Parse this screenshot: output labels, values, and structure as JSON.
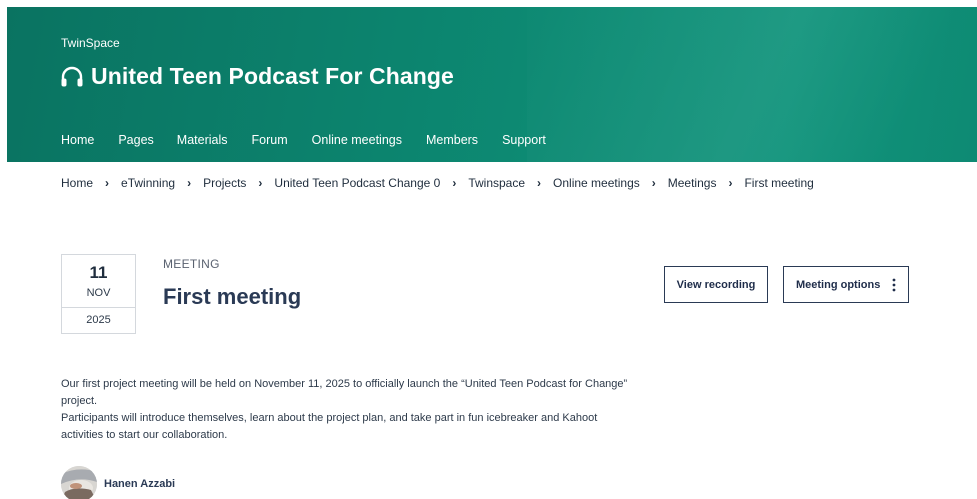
{
  "header": {
    "site_name": "TwinSpace",
    "project_title": "United Teen Podcast For Change",
    "title_icon": "headphones-icon",
    "nav": [
      {
        "label": "Home"
      },
      {
        "label": "Pages"
      },
      {
        "label": "Materials"
      },
      {
        "label": "Forum"
      },
      {
        "label": "Online meetings"
      },
      {
        "label": "Members"
      },
      {
        "label": "Support"
      }
    ],
    "colors": {
      "background": "#0d8a73",
      "text": "#ffffff"
    }
  },
  "breadcrumb": [
    {
      "label": "Home"
    },
    {
      "label": "eTwinning"
    },
    {
      "label": "Projects"
    },
    {
      "label": "United Teen Podcast Change 0"
    },
    {
      "label": "Twinspace"
    },
    {
      "label": "Online meetings"
    },
    {
      "label": "Meetings"
    },
    {
      "label": "First meeting"
    }
  ],
  "meeting": {
    "date": {
      "day": "11",
      "month": "NOV",
      "year": "2025"
    },
    "kind_label": "MEETING",
    "title": "First meeting",
    "actions": {
      "view_recording": "View recording",
      "meeting_options": "Meeting options",
      "options_icon": "kebab-menu-icon"
    },
    "description": [
      "Our first project meeting will be held on November 11, 2025 to officially launch the “United Teen Podcast for Change” project.",
      "Participants will introduce themselves, learn about the project plan, and take part in fun icebreaker and Kahoot activities to start our collaboration."
    ],
    "author": {
      "name": "Hanen Azzabi",
      "avatar": "avatar"
    }
  }
}
